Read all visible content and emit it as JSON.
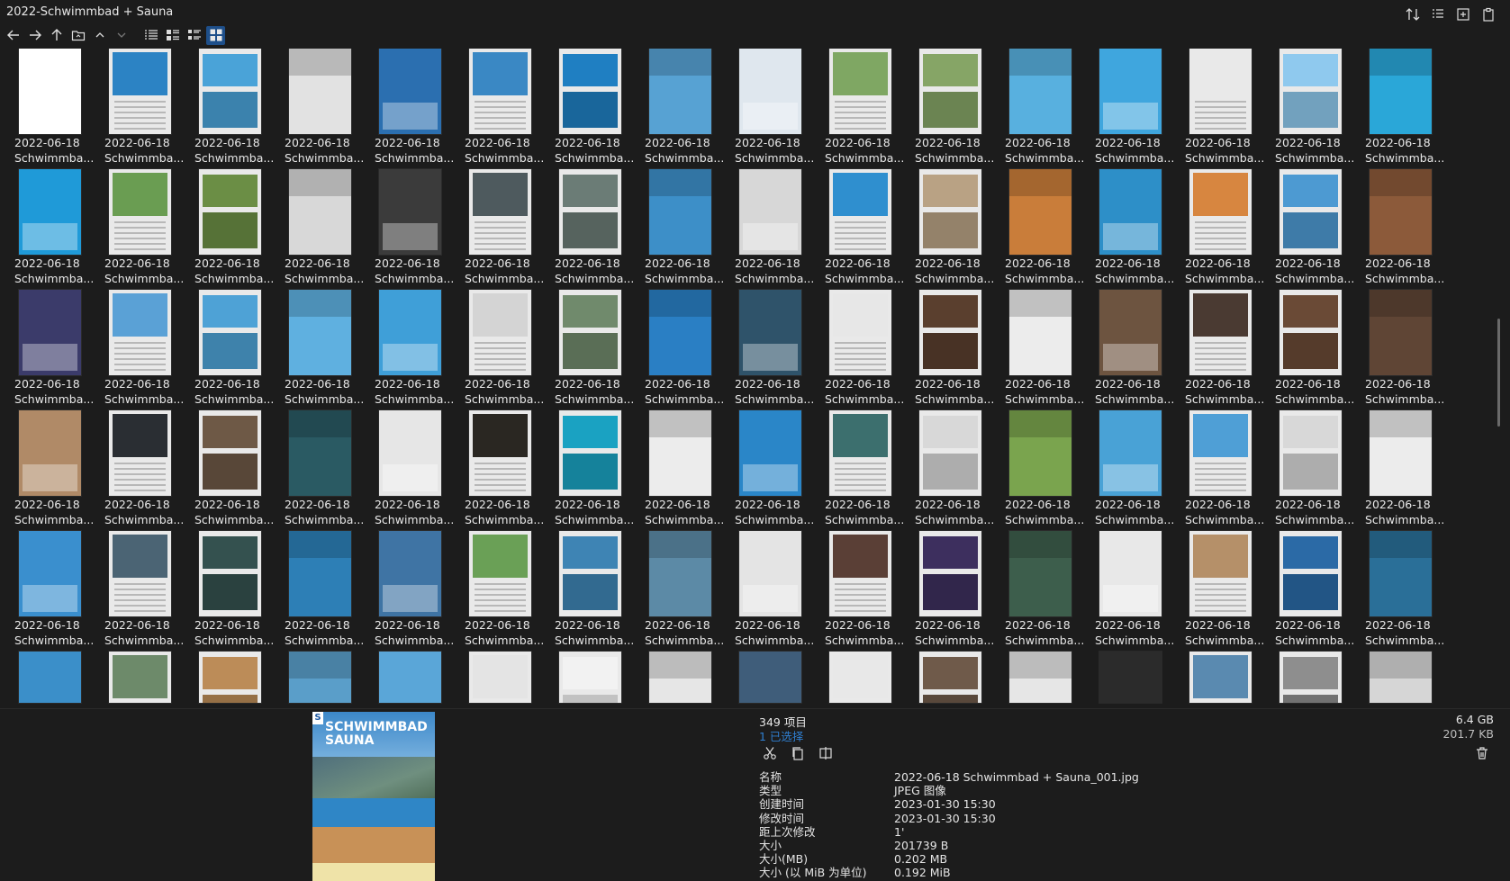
{
  "window": {
    "title": "2022-Schwimmbad + Sauna"
  },
  "toolbar": {
    "buttons": [
      "back-arrow-icon",
      "forward-arrow-icon",
      "up-arrow-icon",
      "open-folder-icon",
      "chevron-up-icon",
      "chevron-down-icon",
      "details-view-icon",
      "list-view-icon",
      "tiles-view-icon",
      "thumbnails-view-icon"
    ],
    "window_buttons": [
      "sort-icon",
      "panel-icon",
      "add-pane-icon",
      "clipboard-icon"
    ]
  },
  "grid": {
    "caption_date": "2022-06-18",
    "caption_name": "Schwimmba...",
    "columns": 16,
    "visible_rows": 6,
    "thumbnail_colors": [
      [
        "#ffffff",
        "#2c83c4",
        "#4aa3d8",
        "#e2e2e2",
        "#2b6fb0",
        "#3a88c4",
        "#1f7fc2",
        "#57a2d3",
        "#dfe7ee",
        "#7fa763",
        "#86a566",
        "#58b0df",
        "#3fa6de",
        "#e9e9e9",
        "#8fc9ee",
        "#2aa7d8"
      ],
      [
        "#1f9ad8",
        "#6a9d52",
        "#6b8e45",
        "#d8d8d8",
        "#3b3b3b",
        "#4e5a5e",
        "#6b7c76",
        "#3d8fc8",
        "#d7d7d7",
        "#2f8fcf",
        "#b9a284",
        "#c97d3a",
        "#2d8fc8",
        "#d78640",
        "#4d9ad2",
        "#8c5a3a"
      ],
      [
        "#3b3b6a",
        "#5aa1d6",
        "#4ea2d6",
        "#5fb0e0",
        "#3f9fd8",
        "#d4d4d4",
        "#708a6c",
        "#2a7fc4",
        "#2f536a",
        "#e7e7e7",
        "#5a3f2e",
        "#ececec",
        "#6d5440",
        "#4a3a32",
        "#6a4a36",
        "#5f4535"
      ],
      [
        "#b08a67",
        "#2a2e33",
        "#6e5946",
        "#2a5a63",
        "#e6e6e6",
        "#2a2722",
        "#1aa2c2",
        "#ececec",
        "#2a86c8",
        "#3c6f6e",
        "#d8d8d8",
        "#7aa44e",
        "#49a2d6",
        "#4f9fd6",
        "#d8d8d8",
        "#ececec"
      ],
      [
        "#3a8fce",
        "#4b6474",
        "#34514f",
        "#2d7fb6",
        "#3f74a4",
        "#6aa056",
        "#3e84b4",
        "#5c8aa6",
        "#e4e4e4",
        "#5a3f36",
        "#3d2f5e",
        "#3d5e4c",
        "#e8e8e8",
        "#b59069",
        "#2b6aa6",
        "#2a6f98"
      ],
      [
        "#3b8fc9",
        "#6d8a6a",
        "#bc8c58",
        "#5a9ec9",
        "#5aa6d8",
        "#e4e4e4",
        "#f2f2f2",
        "#e6e6e6",
        "#3f5d7a",
        "#e8e8e8",
        "#6f5a4a",
        "#e6e6e6",
        "#2b2b2b",
        "#5a8ab0",
        "#8e8e8e",
        "#d6d6d6"
      ]
    ]
  },
  "preview": {
    "logo": "S",
    "title": "SCHWIMMBAD\nSAUNA"
  },
  "status": {
    "item_count": "349 项目",
    "selected": "1 已选择",
    "total_size": "6.4 GB",
    "selected_size": "201.7 KB"
  },
  "actions": [
    "scissors-icon",
    "copy-icon",
    "compare-icon"
  ],
  "properties": [
    {
      "key": "名称",
      "value": "2022-06-18 Schwimmbad + Sauna_001.jpg"
    },
    {
      "key": "类型",
      "value": "JPEG 图像"
    },
    {
      "key": "创建时间",
      "value": "2023-01-30  15:30"
    },
    {
      "key": "修改时间",
      "value": "2023-01-30  15:30"
    },
    {
      "key": "距上次修改",
      "value": "1'"
    },
    {
      "key": "大小",
      "value": "201739 B"
    },
    {
      "key": "大小(MB)",
      "value": "0.202 MB"
    },
    {
      "key": "大小 (以 MiB 为单位)",
      "value": "0.192 MiB"
    }
  ]
}
